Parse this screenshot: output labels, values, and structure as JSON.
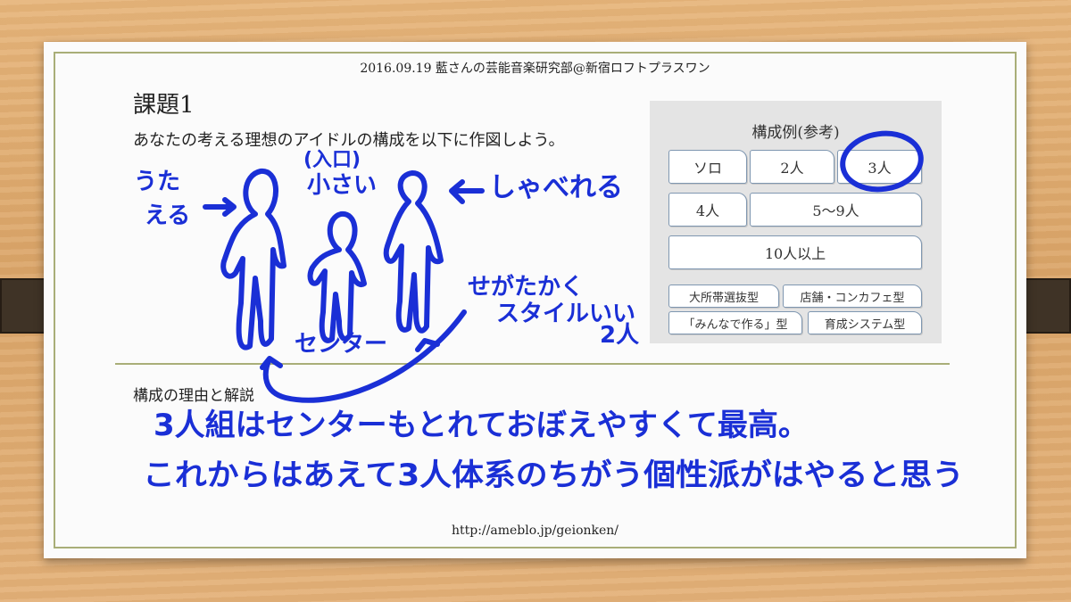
{
  "header": {
    "text": "2016.09.19 藍さんの芸能音楽研究部@新宿ロフトプラスワン"
  },
  "task": {
    "title": "課題1",
    "instruction": "あなたの考える理想のアイドルの構成を以下に作図しよう。"
  },
  "reference_panel": {
    "title": "構成例(参考)",
    "options": [
      "ソロ",
      "2人",
      "3人",
      "4人",
      "5〜9人",
      "10人以上"
    ],
    "types": [
      "大所帯選抜型",
      "店舗・コンカフェ型",
      "「みんなで作る」型",
      "育成システム型"
    ],
    "circled_option": "3人"
  },
  "handwriting": {
    "left_member": [
      "うた",
      "える"
    ],
    "center_member": [
      "(入口)",
      "小さい"
    ],
    "right_member": "しゃべれる",
    "center_label": "センター",
    "pair_note": [
      "せがたかく",
      "スタイルいい",
      "2人"
    ],
    "reason_line_1": "3人組はセンターもとれておぼえやすくて最高。",
    "reason_line_2": "これからはあえて3人体系のちがう個性派がはやると思う"
  },
  "reason_section": {
    "label": "構成の理由と解説"
  },
  "footer": {
    "url": "http://ameblo.jp/geionken/"
  },
  "colors": {
    "ink": "#1a2fd6",
    "frame": "#a9ae78",
    "panel": "#e4e4e4",
    "board": "#dba66a"
  }
}
